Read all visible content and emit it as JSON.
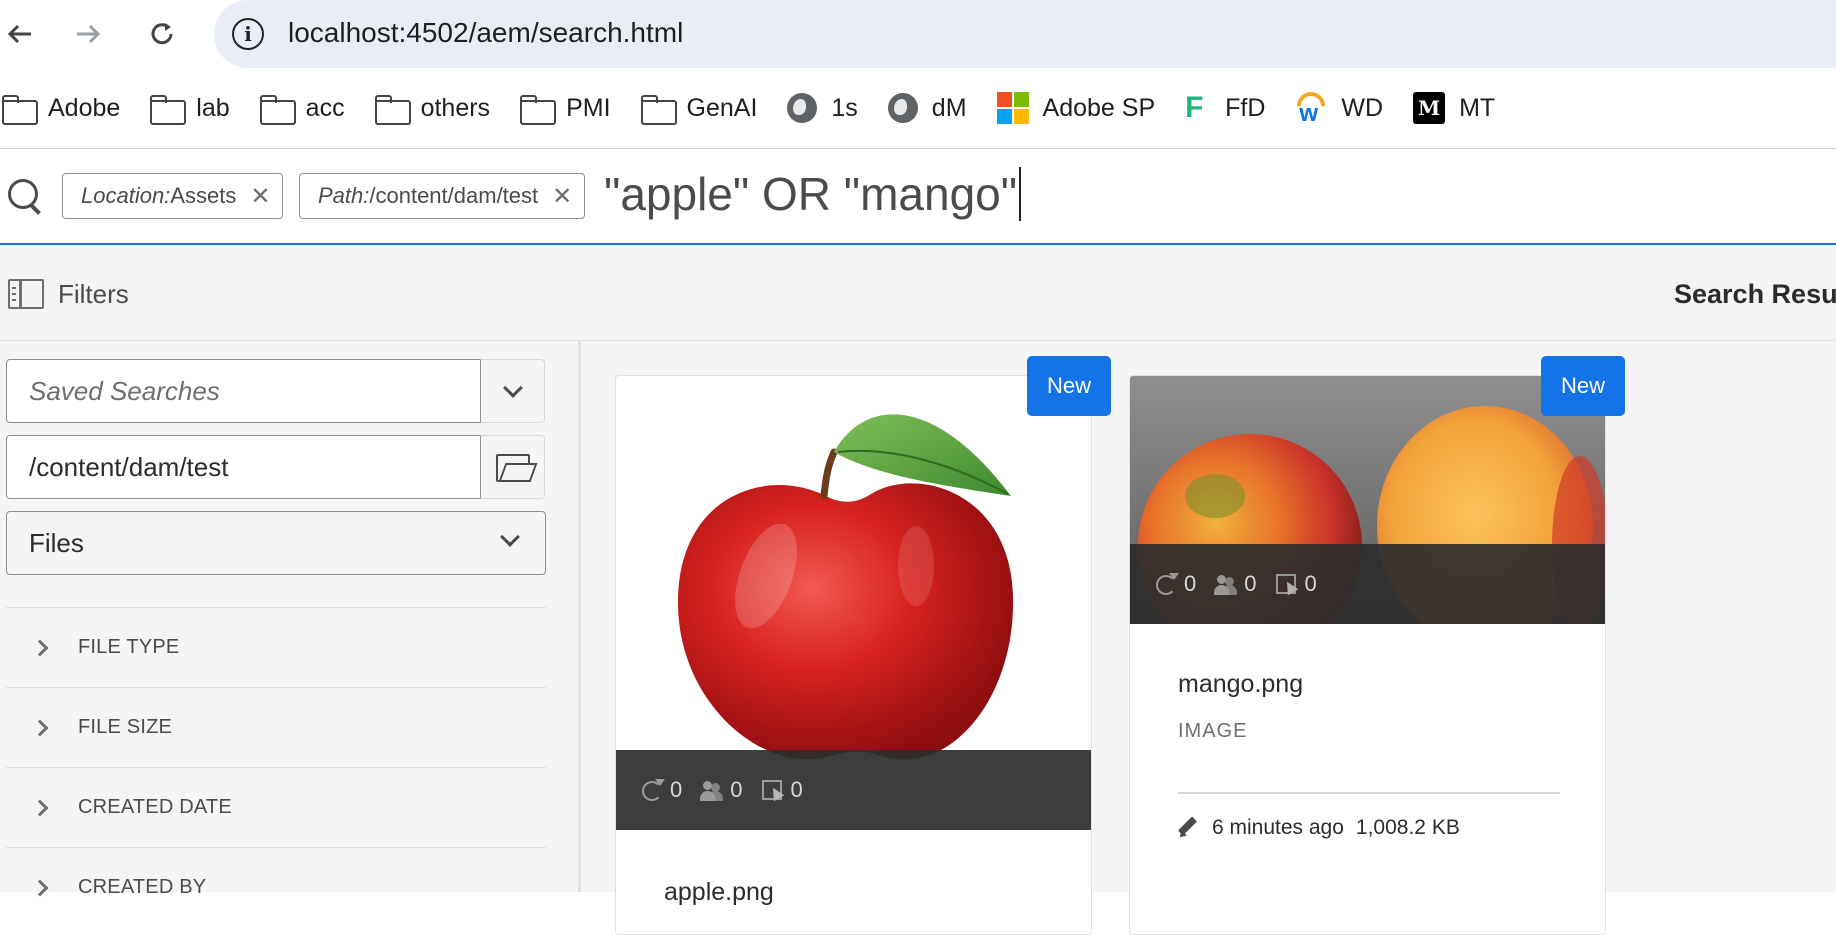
{
  "browser": {
    "url": "localhost:4502/aem/search.html",
    "bookmarks": [
      {
        "label": "Adobe",
        "icon": "folder-icon"
      },
      {
        "label": "lab",
        "icon": "folder-icon"
      },
      {
        "label": "acc",
        "icon": "folder-icon"
      },
      {
        "label": "others",
        "icon": "folder-icon"
      },
      {
        "label": "PMI",
        "icon": "folder-icon"
      },
      {
        "label": "GenAI",
        "icon": "folder-icon"
      },
      {
        "label": "1s",
        "icon": "globe-icon"
      },
      {
        "label": "dM",
        "icon": "globe-icon"
      },
      {
        "label": "Adobe SP",
        "icon": "microsoft-icon"
      },
      {
        "label": "FfD",
        "icon": "f-logo-icon"
      },
      {
        "label": "WD",
        "icon": "workday-icon"
      },
      {
        "label": "MT",
        "icon": "mt-logo-icon"
      }
    ]
  },
  "search": {
    "tags": [
      {
        "key": "Location:",
        "value": " Assets"
      },
      {
        "key": "Path:",
        "value": "/content/dam/test"
      }
    ],
    "query": "\"apple\" OR \"mango\""
  },
  "toolbar": {
    "filters_label": "Filters",
    "results_label": "Search Results"
  },
  "rail": {
    "saved_searches_placeholder": "Saved Searches",
    "path_value": "/content/dam/test",
    "type_select": "Files",
    "sections": [
      "FILE TYPE",
      "FILE SIZE",
      "CREATED DATE",
      "CREATED BY"
    ]
  },
  "cards": [
    {
      "name": "apple.png",
      "badge": "New",
      "stats": {
        "sync": "0",
        "people": "0",
        "selected": "0"
      }
    },
    {
      "name": "mango.png",
      "type": "IMAGE",
      "badge": "New",
      "modified": "6 minutes ago",
      "size": "1,008.2 KB",
      "stats": {
        "sync": "0",
        "people": "0",
        "selected": "0"
      }
    }
  ],
  "colors": {
    "accent": "#1473e6",
    "omnibox": "#e9eef6",
    "rail_bg": "#f5f5f5",
    "stats_bar": "#2d2d2d"
  }
}
